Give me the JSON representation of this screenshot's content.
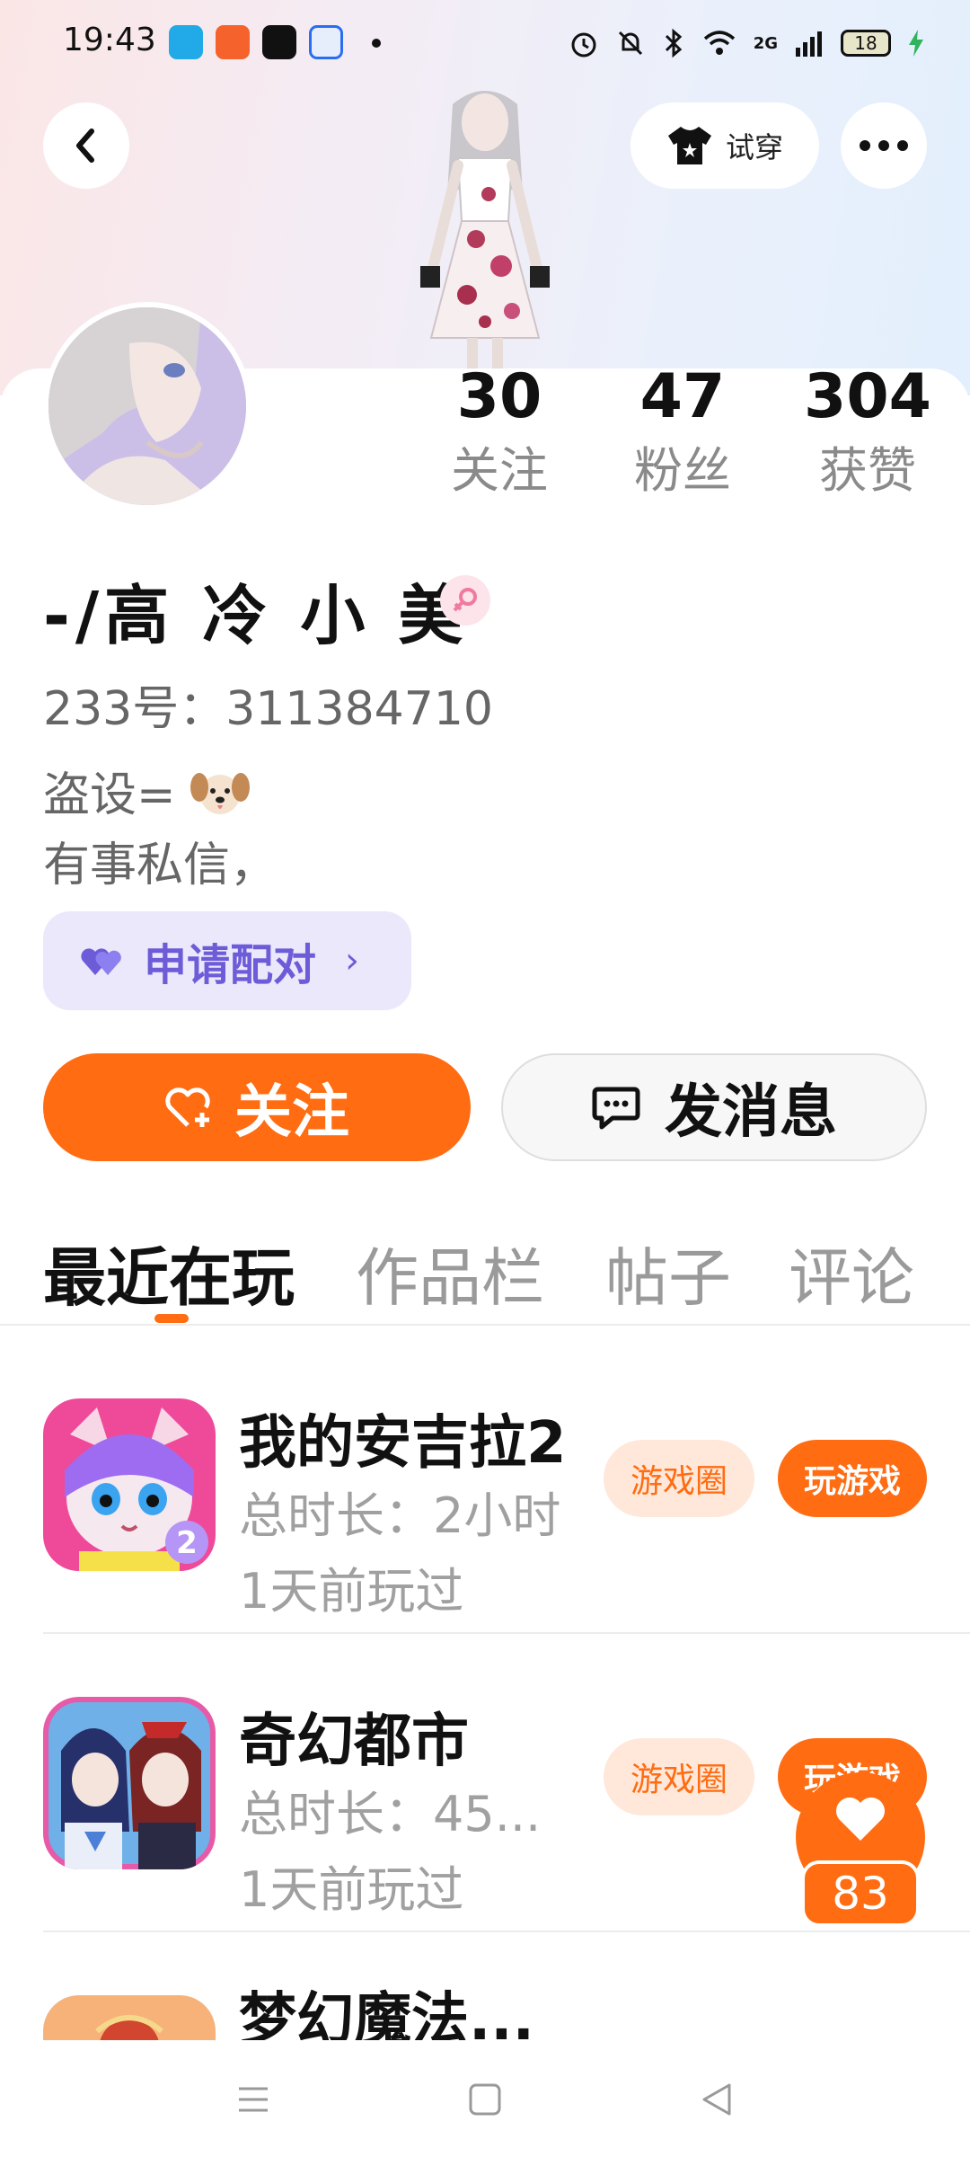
{
  "status_bar": {
    "time": "19:43",
    "network": "2G",
    "battery": "18",
    "icons": [
      "qq-icon",
      "kuaishou-icon",
      "tiktok-icon",
      "browser-icon",
      "alarm-icon",
      "mute-icon",
      "bluetooth-icon",
      "wifi-icon",
      "signal-icon",
      "charging-icon"
    ]
  },
  "header": {
    "tryon_label": "试穿"
  },
  "profile": {
    "stats": [
      {
        "value": "30",
        "label": "关注"
      },
      {
        "value": "47",
        "label": "粉丝"
      },
      {
        "value": "304",
        "label": "获赞"
      }
    ],
    "username": "-/高 冷 小 美",
    "id_line": "233号：311384710",
    "bio_line1": "盗设=",
    "bio_line2": "有事私信，",
    "pair_label": "申请配对",
    "pair_chevron": "›"
  },
  "actions": {
    "follow_label": "关注",
    "message_label": "发消息"
  },
  "tabs": [
    {
      "label": "最近在玩",
      "active": true
    },
    {
      "label": "作品栏",
      "active": false
    },
    {
      "label": "帖子",
      "active": false
    },
    {
      "label": "评论",
      "active": false
    }
  ],
  "games": [
    {
      "name": "我的安吉拉2",
      "duration": "总时长：2小时",
      "last_played": "1天前玩过",
      "circle_label": "游戏圈",
      "play_label": "玩游戏"
    },
    {
      "name": "奇幻都市",
      "duration": "总时长：45...",
      "last_played": "1天前玩过",
      "circle_label": "游戏圈",
      "play_label": "玩游戏"
    },
    {
      "name": "梦幻魔法..."
    }
  ],
  "floating_like": {
    "count": "83"
  },
  "colors": {
    "accent": "#ff6c12",
    "pair_purple": "#6d5cd8",
    "chip_bg": "#ffe8da"
  }
}
